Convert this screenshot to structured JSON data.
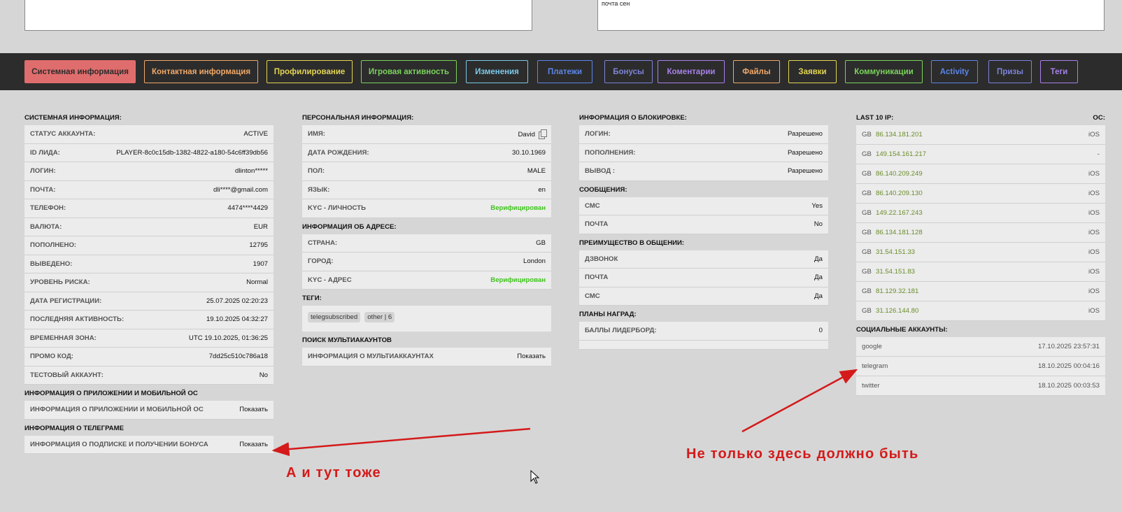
{
  "top_boxes": {
    "left_text": "",
    "right_text": "почта сен"
  },
  "tabs": [
    {
      "label": "Системная информация",
      "color": "#e06d6d",
      "active": true
    },
    {
      "label": "Контактная информация",
      "color": "#f0a868"
    },
    {
      "label": "Профилирование",
      "color": "#e3d552"
    },
    {
      "label": "Игровая активность",
      "color": "#7bd35c"
    },
    {
      "label": "Изменения",
      "color": "#7ec9ea"
    },
    {
      "label": "Платежи",
      "color": "#5b86e8"
    },
    {
      "label": "Бонусы",
      "color": "#7d83d9"
    },
    {
      "label": "Коментарии",
      "color": "#a780e8"
    },
    {
      "label": "Файлы",
      "color": "#f0a868"
    },
    {
      "label": "Заявки",
      "color": "#e3d552"
    },
    {
      "label": "Коммуникации",
      "color": "#7bd35c"
    },
    {
      "label": "Activity",
      "color": "#5b86e8"
    },
    {
      "label": "Призы",
      "color": "#7d83d9"
    },
    {
      "label": "Теги",
      "color": "#a780e8"
    }
  ],
  "col1": {
    "sys_title": "СИСТЕМНАЯ ИНФОРМАЦИЯ:",
    "sys_rows": [
      {
        "label": "СТАТУС АККАУНТА:",
        "value": "ACTIVE"
      },
      {
        "label": "ID ЛИДА:",
        "value": "PLAYER-8c0c15db-1382-4822-a180-54c6ff39db56"
      },
      {
        "label": "ЛОГИН:",
        "value": "dlinton*****"
      },
      {
        "label": "ПОЧТА:",
        "value": "dli****@gmail.com"
      },
      {
        "label": "ТЕЛЕФОН:",
        "value": "4474****4429"
      },
      {
        "label": "ВАЛЮТА:",
        "value": "EUR"
      },
      {
        "label": "ПОПОЛНЕНО:",
        "value": "12795"
      },
      {
        "label": "ВЫВЕДЕНО:",
        "value": "1907"
      },
      {
        "label": "УРОВЕНЬ РИСКА:",
        "value": "Normal"
      },
      {
        "label": "ДАТА РЕГИСТРАЦИИ:",
        "value": "25.07.2025 02:20:23"
      },
      {
        "label": "ПОСЛЕДНЯЯ АКТИВНОСТЬ:",
        "value": "19.10.2025 04:32:27"
      },
      {
        "label": "ВРЕМЕННАЯ ЗОНА:",
        "value": "UTC 19.10.2025, 01:36:25"
      },
      {
        "label": "ПРОМО КОД:",
        "value": "7dd25c510c786a18"
      },
      {
        "label": "ТЕСТОВЫЙ АККАУНТ:",
        "value": "No"
      }
    ],
    "app_title": "ИНФОРМАЦИЯ О ПРИЛОЖЕНИИ И МОБИЛЬНОЙ ОС",
    "app_row": {
      "label": "ИНФОРМАЦИЯ О ПРИЛОЖЕНИИ И МОБИЛЬНОЙ ОС",
      "value": "Показать"
    },
    "tg_title": "ИНФОРМАЦИЯ О ТЕЛЕГРАМЕ",
    "tg_row": {
      "label": "ИНФОРМАЦИЯ О ПОДПИСКЕ И ПОЛУЧЕНИИ БОНУСА",
      "value": "Показать"
    }
  },
  "col2": {
    "personal_title": "ПЕРСОНАЛЬНАЯ ИНФОРМАЦИЯ:",
    "personal_rows": [
      {
        "label": "ИМЯ:",
        "value": "David"
      },
      {
        "label": "ДАТА РОЖДЕНИЯ:",
        "value": "30.10.1969"
      },
      {
        "label": "ПОЛ:",
        "value": "MALE"
      },
      {
        "label": "ЯЗЫК:",
        "value": "en"
      },
      {
        "label": "KYC - ЛИЧНОСТЬ",
        "value": "Верифицирован"
      }
    ],
    "address_title": "ИНФОРМАЦИЯ ОБ АДРЕСЕ:",
    "address_rows": [
      {
        "label": "СТРАНА:",
        "value": "GB"
      },
      {
        "label": "ГОРОД:",
        "value": "London"
      },
      {
        "label": "KYC - АДРЕС",
        "value": "Верифицирован"
      }
    ],
    "tags_title": "ТЕГИ:",
    "tags": [
      "telegsubscribed",
      "other | 6"
    ],
    "multi_title": "ПОИСК МУЛЬТИАКАУНТОВ",
    "multi_row": {
      "label": "ИНФОРМАЦИЯ О МУЛЬТИАККАУНТАХ",
      "value": "Показать"
    }
  },
  "col3": {
    "block_title": "ИНФОРМАЦИЯ О БЛОКИРОВКЕ:",
    "block_rows": [
      {
        "label": "ЛОГИН:",
        "value": "Разрешено"
      },
      {
        "label": "ПОПОЛНЕНИЯ:",
        "value": "Разрешено"
      },
      {
        "label": "ВЫВОД :",
        "value": "Разрешено"
      }
    ],
    "msg_title": "СООБЩЕНИЯ:",
    "msg_rows": [
      {
        "label": "СМС",
        "value": "Yes"
      },
      {
        "label": "ПОЧТА",
        "value": "No"
      }
    ],
    "pref_title": "ПРЕИМУЩЕСТВО В ОБЩЕНИИ:",
    "pref_rows": [
      {
        "label": "ДЗВОНОК",
        "value": "Да"
      },
      {
        "label": "ПОЧТА",
        "value": "Да"
      },
      {
        "label": "СМС",
        "value": "Да"
      }
    ],
    "rewards_title": "ПЛАНЫ НАГРАД:",
    "rewards_rows": [
      {
        "label": "БАЛЛЫ ЛИДЕРБОРД:",
        "value": "0"
      }
    ]
  },
  "col4": {
    "ip_title": "LAST 10 IP:",
    "os_title": "ОС:",
    "ips": [
      {
        "cc": "GB",
        "ip": "86.134.181.201",
        "os": "iOS"
      },
      {
        "cc": "GB",
        "ip": "149.154.161.217",
        "os": "-"
      },
      {
        "cc": "GB",
        "ip": "86.140.209.249",
        "os": "iOS"
      },
      {
        "cc": "GB",
        "ip": "86.140.209.130",
        "os": "iOS"
      },
      {
        "cc": "GB",
        "ip": "149.22.167.243",
        "os": "iOS"
      },
      {
        "cc": "GB",
        "ip": "86.134.181.128",
        "os": "iOS"
      },
      {
        "cc": "GB",
        "ip": "31.54.151.33",
        "os": "iOS"
      },
      {
        "cc": "GB",
        "ip": "31.54.151.83",
        "os": "iOS"
      },
      {
        "cc": "GB",
        "ip": "81.129.32.181",
        "os": "iOS"
      },
      {
        "cc": "GB",
        "ip": "31.126.144.80",
        "os": "iOS"
      }
    ],
    "social_title": "СОЦИАЛЬНЫЕ АККАУНТЫ:",
    "social": [
      {
        "name": "google",
        "date": "17.10.2025 23:57:31"
      },
      {
        "name": "telegram",
        "date": "18.10.2025 00:04:16"
      },
      {
        "name": "twitter",
        "date": "18.10.2025 00:03:53"
      }
    ]
  },
  "annotations": {
    "text_right": "Не только здесь должно быть",
    "text_left": "А и тут тоже",
    "color": "#d41a1a"
  }
}
